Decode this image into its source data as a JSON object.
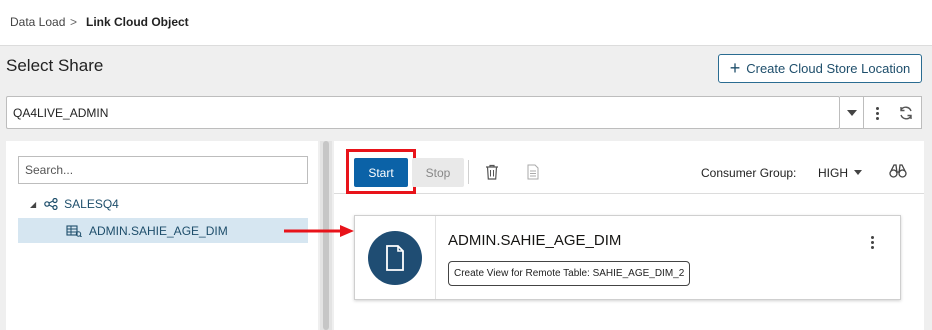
{
  "breadcrumb": {
    "item1": "Data Load",
    "separator": ">",
    "item2": "Link Cloud Object"
  },
  "page": {
    "title": "Select Share"
  },
  "create_button": {
    "label": "Create Cloud Store Location",
    "icon": "plus-icon"
  },
  "share_select": {
    "value": "QA4LIVE_ADMIN"
  },
  "search": {
    "placeholder": "Search..."
  },
  "tree": {
    "share_label": "SALESQ4",
    "table_label": "ADMIN.SAHIE_AGE_DIM"
  },
  "toolbar": {
    "start_label": "Start",
    "stop_label": "Stop",
    "consumer_group_label": "Consumer Group:",
    "consumer_group_value": "HIGH"
  },
  "card": {
    "title": "ADMIN.SAHIE_AGE_DIM",
    "chip_label": "Create View for Remote Table: SAHIE_AGE_DIM_2"
  },
  "colors": {
    "primary_button": "#0b62a7",
    "highlight": "#e8131a",
    "arrow": "#e8131a",
    "selected_row": "#d6e6f1",
    "card_icon_bg": "#1f4d73",
    "link_text": "#1e4e6b"
  }
}
